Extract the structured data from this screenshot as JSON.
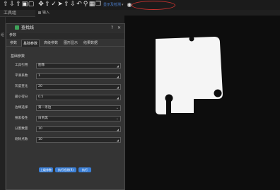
{
  "toolbar": {
    "icons": [
      "arrow-up-icon",
      "arrow-down-icon",
      "upload-icon",
      "lock-icon",
      "unlock-icon",
      "arrow-up-icon",
      "arrow-down-icon",
      "move-icon",
      "arrow-up-icon",
      "pin-icon",
      "cursor-icon",
      "arrow-up-icon",
      "arrow-down-icon",
      "undo-icon",
      "link-icon",
      "grid-icon",
      "layers-icon"
    ],
    "display_mode_label": "显示及检测",
    "circle_icon": "target-icon"
  },
  "left_panel": {
    "tab_label": "工具组",
    "strip_label": "组"
  },
  "image_tab": {
    "label": "输入"
  },
  "dialog": {
    "title": "查找线",
    "help": "?",
    "close": "✕",
    "param_header": "参数",
    "tabs": [
      {
        "label": "参数",
        "active": false
      },
      {
        "label": "基础参数",
        "active": true
      },
      {
        "label": "高级参数",
        "active": false
      },
      {
        "label": "图形显示",
        "active": false
      },
      {
        "label": "结果数据",
        "active": false
      }
    ],
    "section_title": "基础参数",
    "rows": [
      {
        "label": "工具引用",
        "value": "图像",
        "control": "text"
      },
      {
        "label": "平滑系数",
        "value": "1",
        "control": "text"
      },
      {
        "label": "灰度变化",
        "value": "20",
        "control": "text"
      },
      {
        "label": "最小得分",
        "value": "0.5",
        "control": "text"
      },
      {
        "label": "边缘选择",
        "value": "第一条边",
        "control": "select"
      },
      {
        "label": "搜索极性",
        "value": "白到黑",
        "control": "select"
      },
      {
        "label": "分割数量",
        "value": "10",
        "control": "text"
      },
      {
        "label": "剔除点数",
        "value": "10",
        "control": "text"
      }
    ],
    "buttons": [
      "上级参数",
      "执行检测(R)",
      "执行"
    ]
  },
  "colors": {
    "accent": "#3b7fd6",
    "highlight_ellipse": "#c8322f",
    "part_fill": "#f5f5f5"
  }
}
